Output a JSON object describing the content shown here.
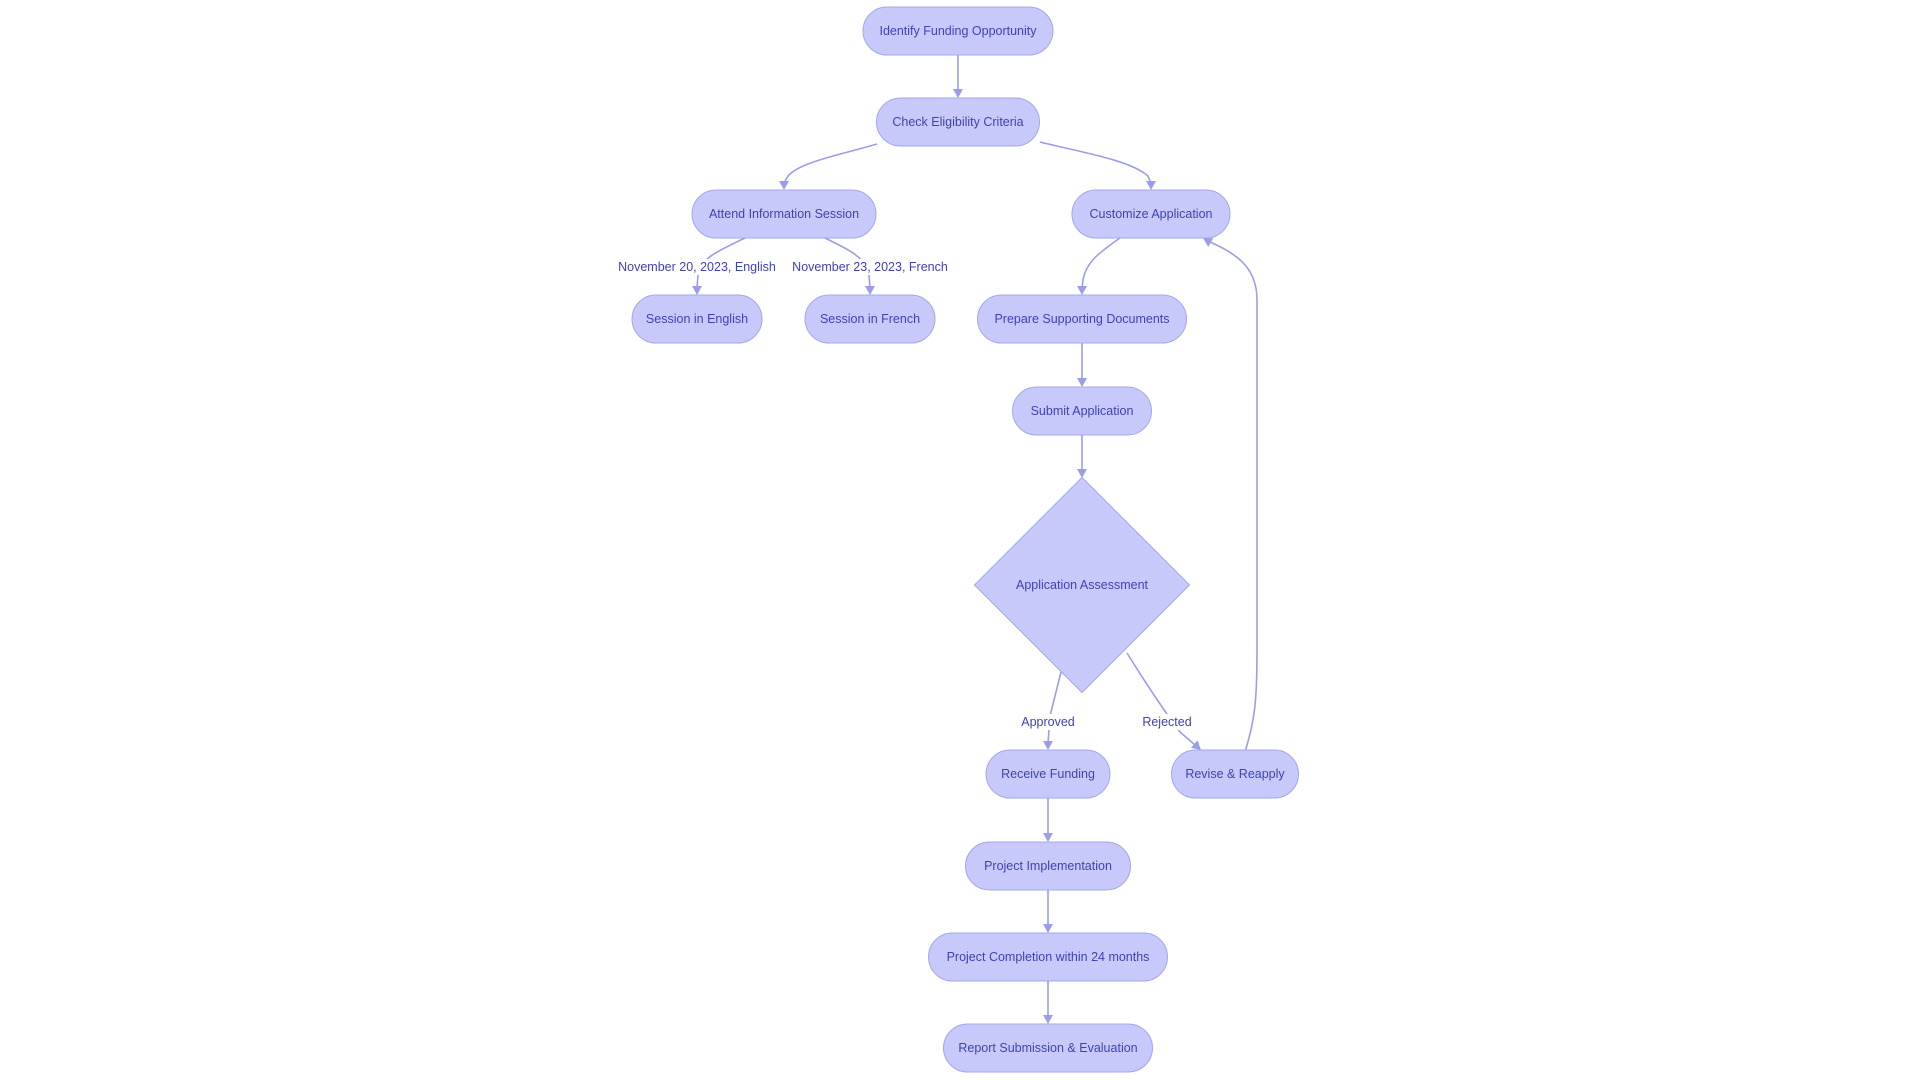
{
  "diagram": {
    "type": "flowchart",
    "colors": {
      "node_fill": "#c8c9fb",
      "node_stroke": "#a3a6ee",
      "edge": "#9a9ee8",
      "text": "#3d42b5",
      "background": "#ffffff"
    },
    "nodes": [
      {
        "id": "identify",
        "label": "Identify Funding Opportunity",
        "shape": "stadium"
      },
      {
        "id": "check",
        "label": "Check Eligibility Criteria",
        "shape": "stadium"
      },
      {
        "id": "attend",
        "label": "Attend Information Session",
        "shape": "stadium"
      },
      {
        "id": "customize",
        "label": "Customize Application",
        "shape": "stadium"
      },
      {
        "id": "english",
        "label": "Session in English",
        "shape": "stadium"
      },
      {
        "id": "french",
        "label": "Session in French",
        "shape": "stadium"
      },
      {
        "id": "prepare",
        "label": "Prepare Supporting Documents",
        "shape": "stadium"
      },
      {
        "id": "submit",
        "label": "Submit Application",
        "shape": "stadium"
      },
      {
        "id": "assess",
        "label": "Application Assessment",
        "shape": "diamond"
      },
      {
        "id": "receive",
        "label": "Receive Funding",
        "shape": "stadium"
      },
      {
        "id": "revise",
        "label": "Revise & Reapply",
        "shape": "stadium"
      },
      {
        "id": "implement",
        "label": "Project Implementation",
        "shape": "stadium"
      },
      {
        "id": "complete",
        "label": "Project Completion within 24 months",
        "shape": "stadium"
      },
      {
        "id": "report",
        "label": "Report Submission & Evaluation",
        "shape": "stadium"
      }
    ],
    "edges": [
      {
        "from": "identify",
        "to": "check",
        "label": ""
      },
      {
        "from": "check",
        "to": "attend",
        "label": ""
      },
      {
        "from": "check",
        "to": "customize",
        "label": ""
      },
      {
        "from": "attend",
        "to": "english",
        "label": "November 20, 2023, English"
      },
      {
        "from": "attend",
        "to": "french",
        "label": "November 23, 2023, French"
      },
      {
        "from": "customize",
        "to": "prepare",
        "label": ""
      },
      {
        "from": "prepare",
        "to": "submit",
        "label": ""
      },
      {
        "from": "submit",
        "to": "assess",
        "label": ""
      },
      {
        "from": "assess",
        "to": "receive",
        "label": "Approved"
      },
      {
        "from": "assess",
        "to": "revise",
        "label": "Rejected"
      },
      {
        "from": "revise",
        "to": "customize",
        "label": ""
      },
      {
        "from": "receive",
        "to": "implement",
        "label": ""
      },
      {
        "from": "implement",
        "to": "complete",
        "label": ""
      },
      {
        "from": "complete",
        "to": "report",
        "label": ""
      }
    ]
  }
}
